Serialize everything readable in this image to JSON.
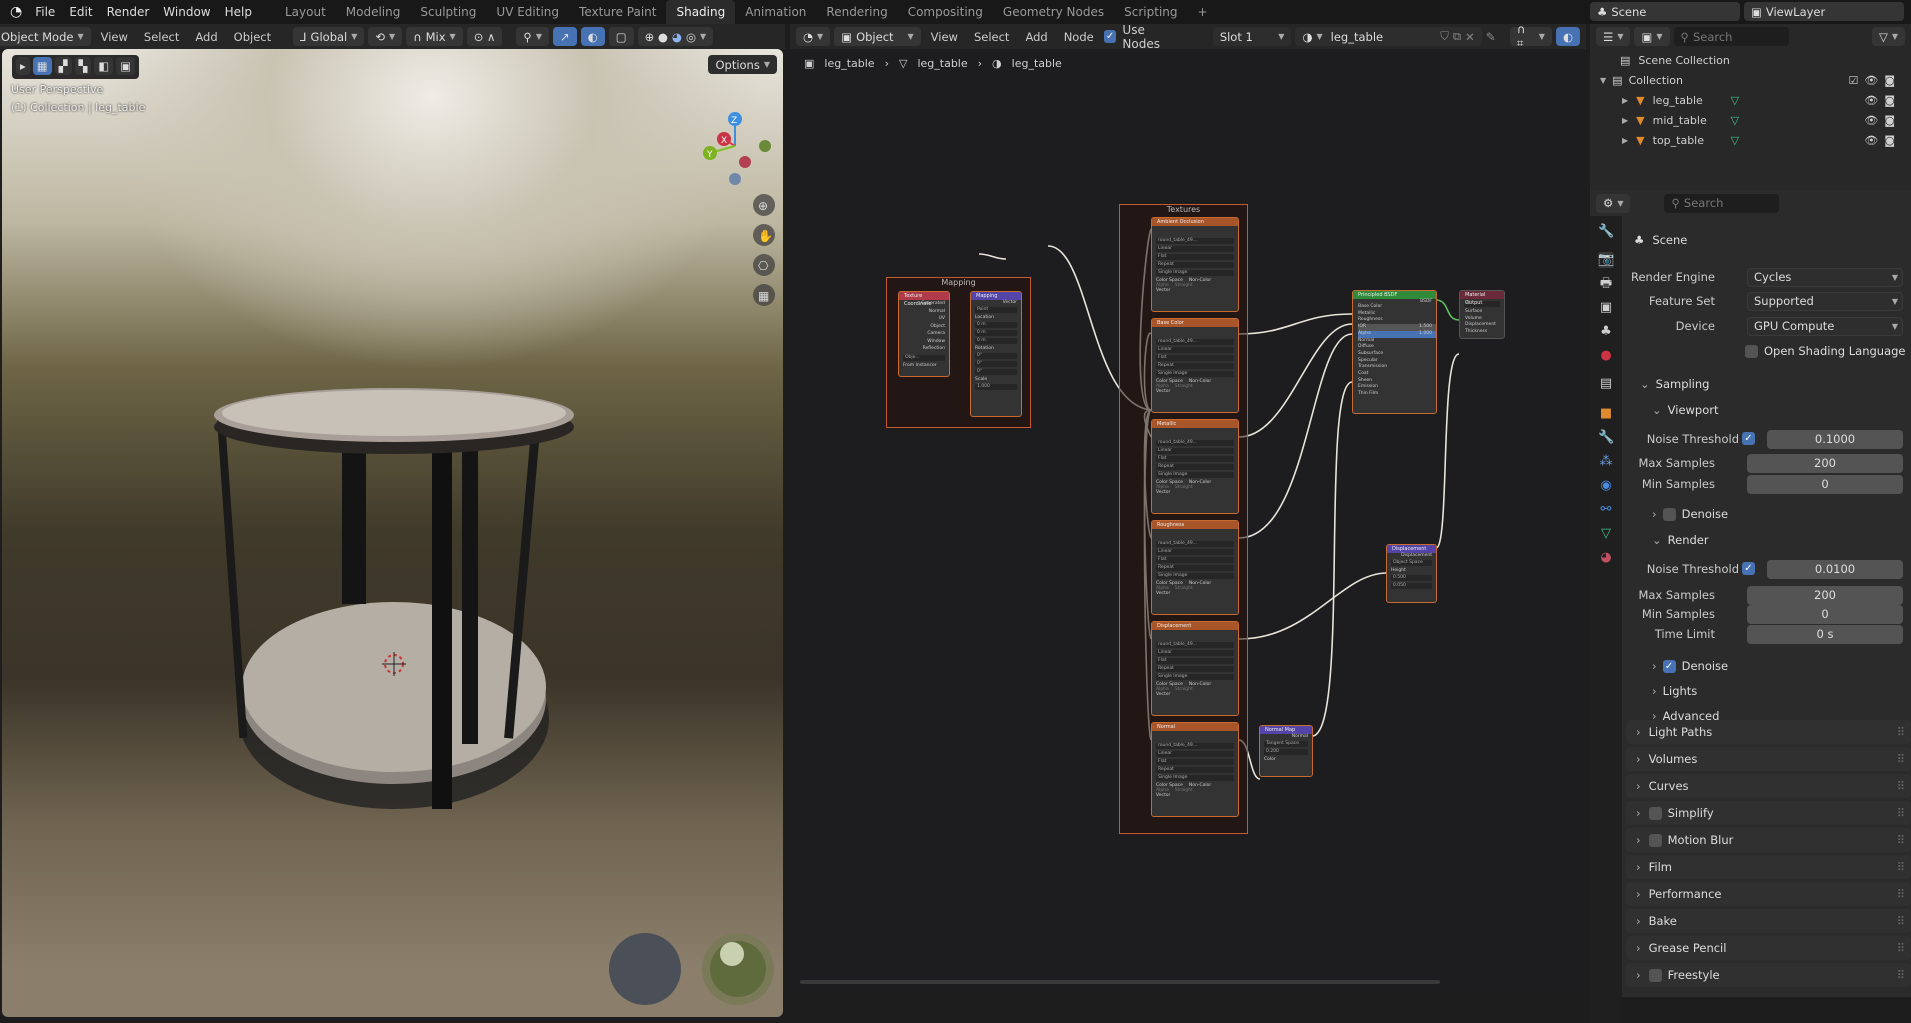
{
  "topbar": {
    "menus": [
      "File",
      "Edit",
      "Render",
      "Window",
      "Help"
    ],
    "workspaces": [
      "Layout",
      "Modeling",
      "Sculpting",
      "UV Editing",
      "Texture Paint",
      "Shading",
      "Animation",
      "Rendering",
      "Compositing",
      "Geometry Nodes",
      "Scripting",
      "+"
    ],
    "active_workspace": "Shading",
    "scene": "Scene",
    "view_layer": "ViewLayer"
  },
  "viewport": {
    "mode": "Object Mode",
    "menus": [
      "View",
      "Select",
      "Add",
      "Object"
    ],
    "transform_orientation": "Global",
    "snap_mode": "Mix",
    "options_label": "Options",
    "overlay_text": "User Perspective",
    "collection_text": "(1) Collection | leg_table",
    "gizmo_axes": [
      "Z",
      "X",
      "Y"
    ]
  },
  "node_editor": {
    "object_type": "Object",
    "menus": [
      "View",
      "Select",
      "Add",
      "Node"
    ],
    "use_nodes_label": "Use Nodes",
    "use_nodes": true,
    "slot": "Slot 1",
    "material": "leg_table",
    "breadcrumbs": [
      "leg_table",
      "leg_table",
      "leg_table"
    ],
    "frames": {
      "mapping": "Mapping",
      "textures": "Textures"
    },
    "nodes": {
      "tex_coord": {
        "title": "Texture Coordinate",
        "outputs": [
          "Generated",
          "Normal",
          "UV",
          "Object",
          "Camera",
          "Window",
          "Reflection"
        ],
        "object_label": "Obje...",
        "instancer": "From Instancer"
      },
      "mapping": {
        "title": "Mapping",
        "output": "Vector",
        "type_label": "Type:",
        "type": "Point",
        "inputs": [
          "Vector",
          "Location",
          "Rotation",
          "Scale"
        ],
        "location": [
          "0 m",
          "0 m",
          "0 m"
        ],
        "rotation": [
          "0°",
          "0°",
          "0°"
        ],
        "scale": [
          "1.000",
          "1.000",
          "1.000"
        ]
      },
      "textures": [
        {
          "title": "Ambient Occlusion",
          "image": "round_table_49..."
        },
        {
          "title": "Base Color",
          "image": "round_table_49..."
        },
        {
          "title": "Metallic",
          "image": "round_table_49..."
        },
        {
          "title": "Roughness",
          "image": "round_table_49..."
        },
        {
          "title": "Displacement",
          "image": "round_table_49..."
        },
        {
          "title": "Normal",
          "image": "round_table_49..."
        }
      ],
      "texture_rows": [
        "Linear",
        "Flat",
        "Repeat",
        "Single Image",
        "Color Space",
        "Non-Color",
        "Alpha",
        "Straight",
        "Vector"
      ],
      "bsdf": {
        "title": "Principled BSDF",
        "output": "BSDF",
        "inputs": [
          "Base Color",
          "Metallic",
          "Roughness",
          "IOR",
          "Alpha",
          "Normal",
          "Diffuse",
          "Subsurface",
          "Specular",
          "Transmission",
          "Coat",
          "Sheen",
          "Emission",
          "Thin Film"
        ],
        "ior": "1.500",
        "alpha": "1.000"
      },
      "output": {
        "title": "Material Output",
        "target": "All",
        "inputs": [
          "Surface",
          "Volume",
          "Displacement",
          "Thickness"
        ]
      },
      "displacement": {
        "title": "Displacement",
        "output": "Displacement",
        "space": "Object Space",
        "inputs": [
          "Height",
          "Midlevel",
          "Scale",
          "Normal"
        ],
        "midlevel": "0.500",
        "scale": "0.050"
      },
      "normal_map": {
        "title": "Normal Map",
        "output": "Normal",
        "space": "Tangent Space",
        "strength_label": "Strength",
        "strength": "0.200",
        "input": "Color"
      }
    }
  },
  "outliner": {
    "search_placeholder": "Search",
    "scene_collection": "Scene Collection",
    "collection": "Collection",
    "objects": [
      "leg_table",
      "mid_table",
      "top_table"
    ]
  },
  "properties": {
    "search_placeholder": "Search",
    "context": "Scene",
    "render_engine_label": "Render Engine",
    "render_engine": "Cycles",
    "feature_set_label": "Feature Set",
    "feature_set": "Supported",
    "device_label": "Device",
    "device": "GPU Compute",
    "osl_label": "Open Shading Language",
    "sampling": "Sampling",
    "viewport": {
      "title": "Viewport",
      "noise_label": "Noise Threshold",
      "noise": "0.1000",
      "max_label": "Max Samples",
      "max": "200",
      "min_label": "Min Samples",
      "min": "0",
      "denoise": "Denoise"
    },
    "render": {
      "title": "Render",
      "noise_label": "Noise Threshold",
      "noise": "0.0100",
      "max_label": "Max Samples",
      "max": "200",
      "min_label": "Min Samples",
      "min": "0",
      "time_label": "Time Limit",
      "time": "0 s",
      "denoise": "Denoise"
    },
    "sub_panels": [
      "Lights",
      "Advanced"
    ],
    "panels": [
      "Light Paths",
      "Volumes",
      "Curves",
      "Simplify",
      "Motion Blur",
      "Film",
      "Performance",
      "Bake",
      "Grease Pencil",
      "Freestyle"
    ]
  }
}
